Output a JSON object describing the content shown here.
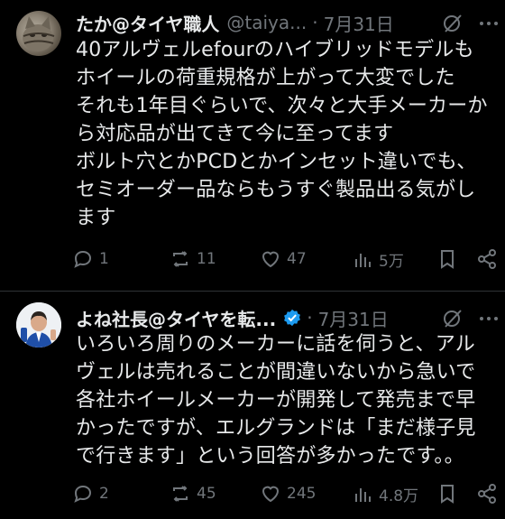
{
  "tweets": [
    {
      "name": "たか@タイヤ職人",
      "handle": "@taiya...",
      "date": "7月31日",
      "verified": false,
      "text": "40アルヴェルefourのハイブリッドモデルも\nホイールの荷重規格が上がって大変でした\nそれも1年目ぐらいで、次々と大手メーカーか\nら対応品が出てきて今に至ってます\nボルト穴とかPCDとかインセット違いでも、\nセミオーダー品ならもうすぐ製品出る気がし\nます",
      "replies": "1",
      "reposts": "11",
      "likes": "47",
      "views": "5万"
    },
    {
      "name": "よね社長@タイヤを転...",
      "handle": "",
      "date": "7月31日",
      "verified": true,
      "text": "いろいろ周りのメーカーに話を伺うと、アル\nヴェルは売れることが間違いないから急いで\n各社ホイールメーカーが開発して発売まで早\nかったですが、エルグランドは「まだ様子見\nで行きます」という回答が多かったです。。",
      "replies": "2",
      "reposts": "45",
      "likes": "245",
      "views": "4.8万"
    }
  ],
  "colors": {
    "text": "#e7e9ea",
    "muted": "#71767b",
    "verified": "#1d9bf0",
    "background": "#000000"
  }
}
